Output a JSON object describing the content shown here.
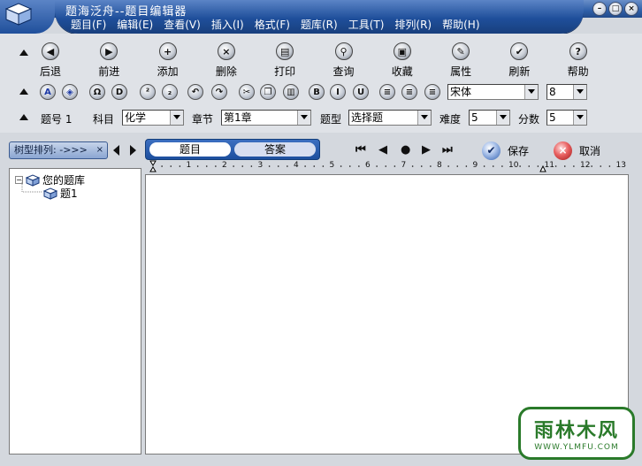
{
  "window": {
    "title": "题海泛舟--题目编辑器",
    "controls": [
      "minimize",
      "maximize",
      "close"
    ]
  },
  "menu": [
    "题目(F)",
    "编辑(E)",
    "查看(V)",
    "插入(I)",
    "格式(F)",
    "题库(R)",
    "工具(T)",
    "排列(R)",
    "帮助(H)"
  ],
  "main_toolbar": [
    {
      "label": "后退",
      "icon": "back-icon",
      "glyph": "◀"
    },
    {
      "label": "前进",
      "icon": "forward-icon",
      "glyph": "▶"
    },
    {
      "label": "添加",
      "icon": "add-icon",
      "glyph": "+"
    },
    {
      "label": "删除",
      "icon": "delete-icon",
      "glyph": "×"
    },
    {
      "label": "打印",
      "icon": "print-icon",
      "glyph": "▤"
    },
    {
      "label": "查询",
      "icon": "search-icon",
      "glyph": "⚲"
    },
    {
      "label": "收藏",
      "icon": "favorite-icon",
      "glyph": "▣"
    },
    {
      "label": "属性",
      "icon": "properties-icon",
      "glyph": "✎"
    },
    {
      "label": "刷新",
      "icon": "refresh-icon",
      "glyph": "✔"
    },
    {
      "label": "帮助",
      "icon": "help-icon",
      "glyph": "?"
    }
  ],
  "format_toolbar": {
    "buttons": [
      {
        "name": "font-color-icon",
        "glyph": "A"
      },
      {
        "name": "fill-icon",
        "glyph": "◈"
      },
      {
        "name": "omega-icon",
        "glyph": "Ω"
      },
      {
        "name": "d-icon",
        "glyph": "D"
      },
      {
        "name": "superscript-icon",
        "glyph": "²"
      },
      {
        "name": "subscript-icon",
        "glyph": "₂"
      },
      {
        "name": "undo-icon",
        "glyph": "↶"
      },
      {
        "name": "redo-icon",
        "glyph": "↷"
      },
      {
        "name": "cut-icon",
        "glyph": "✂"
      },
      {
        "name": "copy-icon",
        "glyph": "❐"
      },
      {
        "name": "paste-icon",
        "glyph": "▥"
      },
      {
        "name": "bold-icon",
        "glyph": "B"
      },
      {
        "name": "italic-icon",
        "glyph": "I"
      },
      {
        "name": "underline-icon",
        "glyph": "U"
      },
      {
        "name": "align-left-icon",
        "glyph": "≡"
      },
      {
        "name": "align-center-icon",
        "glyph": "≡"
      },
      {
        "name": "align-right-icon",
        "glyph": "≡"
      }
    ],
    "font_name": "宋体",
    "font_size": "8"
  },
  "question_fields": {
    "number_label": "题号 1",
    "subject_label": "科目",
    "subject_value": "化学",
    "chapter_label": "章节",
    "chapter_value": "第1章",
    "type_label": "题型",
    "type_value": "选择题",
    "difficulty_label": "难度",
    "difficulty_value": "5",
    "score_label": "分数",
    "score_value": "5"
  },
  "tree_sort": {
    "label": "树型排列:",
    "value": "->>>",
    "close": "×"
  },
  "tabs": [
    {
      "label": "题目",
      "active": true
    },
    {
      "label": "答案",
      "active": false
    }
  ],
  "record_nav": {
    "first": "⏮",
    "prev": "◀",
    "dot": "●",
    "next": "▶",
    "last": "⏭"
  },
  "actions": {
    "save": "保存",
    "cancel": "取消"
  },
  "ruler_numbers": [
    "1",
    "2",
    "3",
    "4",
    "5",
    "6",
    "7",
    "8",
    "9",
    "10",
    "11",
    "12",
    "13"
  ],
  "tree": {
    "root": "您的题库",
    "children": [
      "题1"
    ]
  },
  "watermark": {
    "main": "雨林木风",
    "sub": "WWW.YLMFU.COM"
  }
}
